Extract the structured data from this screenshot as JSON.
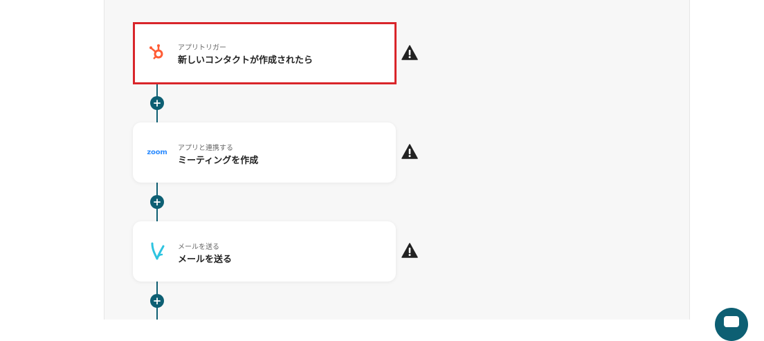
{
  "flow": {
    "steps": [
      {
        "subtitle": "アプリトリガー",
        "title": "新しいコンタクトが作成されたら",
        "icon": "hubspot-icon",
        "highlighted": true
      },
      {
        "subtitle": "アプリと連携する",
        "title": "ミーティングを作成",
        "icon": "zoom-icon",
        "icon_text": "zoom",
        "highlighted": false
      },
      {
        "subtitle": "メールを送る",
        "title": "メールを送る",
        "icon": "yoom-mail-icon",
        "highlighted": false
      }
    ],
    "add_step_symbol": "+",
    "warning_icon": "warning-triangle-icon"
  },
  "colors": {
    "highlight_border": "#d9252a",
    "connector": "#0d5f73",
    "hubspot": "#ff5c35",
    "zoom": "#2d8cff",
    "mail": "#2ec4e0",
    "canvas_bg": "#f7f7f7"
  },
  "chat_button": {
    "icon": "chat-icon"
  }
}
